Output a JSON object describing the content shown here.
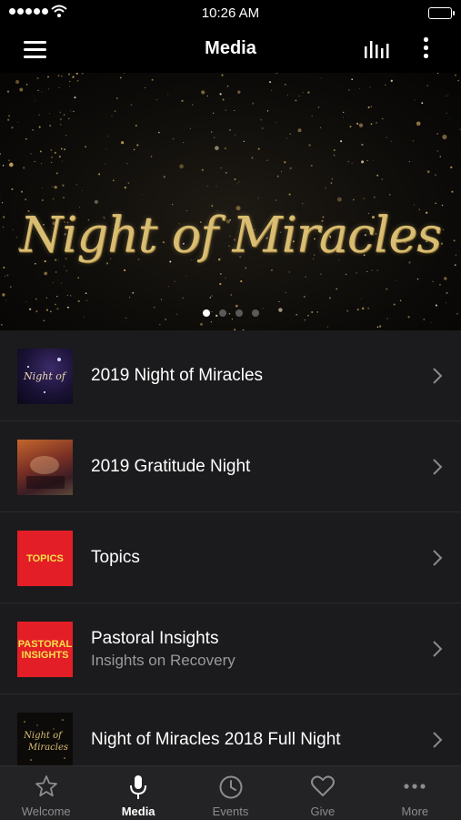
{
  "status_bar": {
    "time": "10:26 AM"
  },
  "header": {
    "title": "Media"
  },
  "hero": {
    "title": "Night of Miracles",
    "page_count": 4,
    "active_page": 0
  },
  "media_list": [
    {
      "title": "2019 Night of Miracles",
      "subtitle": "",
      "thumb_text": "Night of"
    },
    {
      "title": "2019 Gratitude Night",
      "subtitle": "",
      "thumb_text": ""
    },
    {
      "title": "Topics",
      "subtitle": "",
      "thumb_text": "TOPICS"
    },
    {
      "title": "Pastoral Insights",
      "subtitle": "Insights on Recovery",
      "thumb_text_1": "PASTORAL",
      "thumb_text_2": "INSIGHTS"
    },
    {
      "title": "Night of Miracles 2018 Full Night",
      "subtitle": "",
      "thumb_text_1": "Night of",
      "thumb_text_2": "Miracles"
    }
  ],
  "tab_bar": [
    {
      "label": "Welcome",
      "icon": "star-icon"
    },
    {
      "label": "Media",
      "icon": "microphone-icon",
      "active": true
    },
    {
      "label": "Events",
      "icon": "clock-icon"
    },
    {
      "label": "Give",
      "icon": "heart-icon"
    },
    {
      "label": "More",
      "icon": "ellipsis-icon"
    }
  ],
  "colors": {
    "accent_gold": "#d9bd73",
    "thumb_red": "#e31e26",
    "thumb_yellow_text": "#f4e14a",
    "background": "#1b1b1d"
  }
}
